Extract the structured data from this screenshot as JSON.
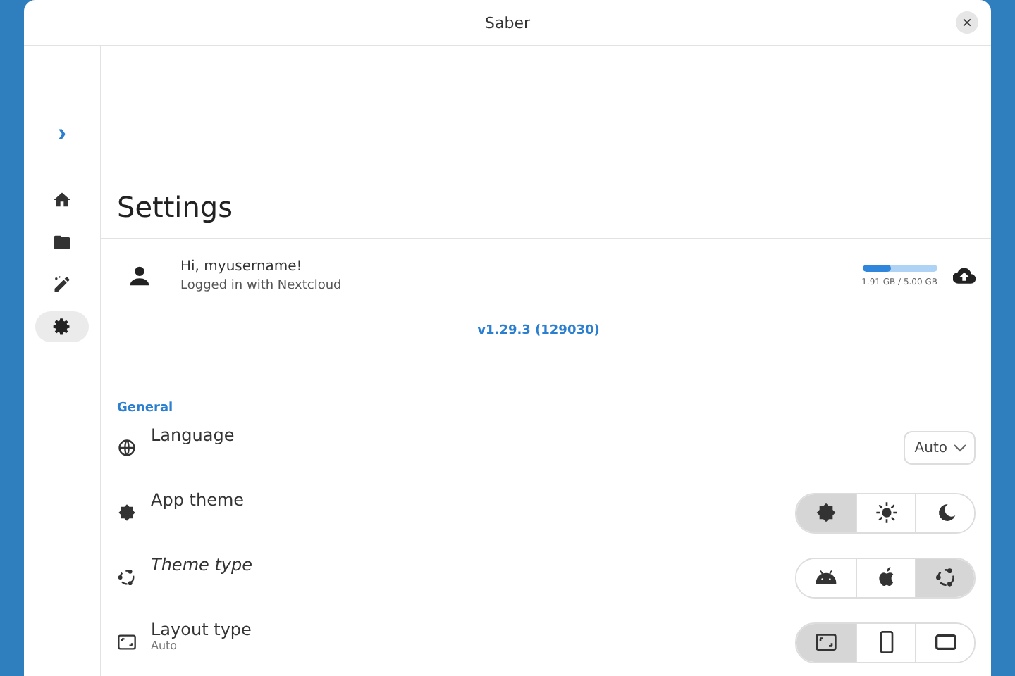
{
  "window": {
    "title": "Saber",
    "close": "×"
  },
  "sidebar": {
    "expand": "›",
    "items": [
      {
        "kind": "home",
        "selected": false
      },
      {
        "kind": "folder",
        "selected": false
      },
      {
        "kind": "whiteboard",
        "selected": false
      },
      {
        "kind": "settings",
        "selected": true
      }
    ]
  },
  "page_title": "Settings",
  "account": {
    "greeting": "Hi, myusername!",
    "status": "Logged in with Nextcloud",
    "storage": {
      "level": 0.38,
      "reading": "1.91 GB / 5.00 GB"
    }
  },
  "version": "v1.29.3 (129030)",
  "section": "General",
  "settings": [
    {
      "kind": "dropdown",
      "label": "Language",
      "italic": false,
      "value": "Auto"
    },
    {
      "kind": "segmented",
      "label": "App theme",
      "italic": false,
      "options": [
        {
          "kind": "auto",
          "selected": true
        },
        {
          "kind": "sun",
          "selected": false
        },
        {
          "kind": "moon",
          "selected": false
        }
      ]
    },
    {
      "kind": "segmented",
      "label": "Theme type",
      "italic": true,
      "options": [
        {
          "kind": "android",
          "selected": false
        },
        {
          "kind": "apple",
          "selected": false
        },
        {
          "kind": "ring",
          "selected": true
        }
      ]
    },
    {
      "kind": "segmented",
      "label": "Layout type",
      "italic": false,
      "subtitle": "Auto",
      "options": [
        {
          "kind": "layout",
          "selected": true
        },
        {
          "kind": "phone",
          "selected": false
        },
        {
          "kind": "tablet",
          "selected": false
        }
      ]
    }
  ]
}
